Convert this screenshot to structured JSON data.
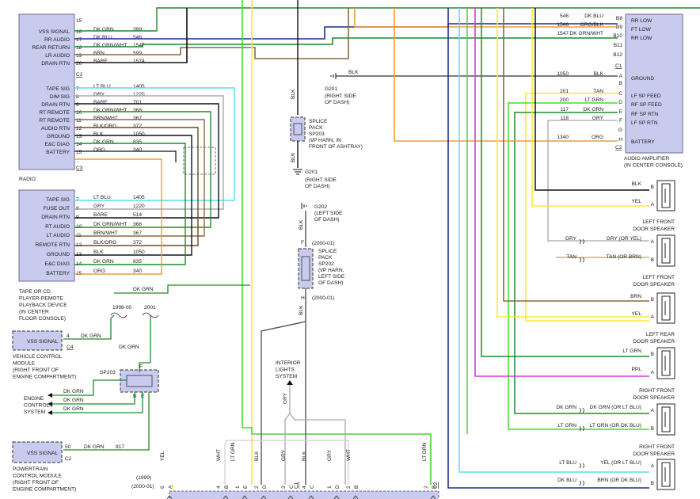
{
  "components": {
    "radio": {
      "name": "RADIO",
      "pins": [
        {
          "pin": "15",
          "label": "",
          "wire": "",
          "circuit": ""
        },
        {
          "pin": "16",
          "label": "VSS SIGNAL",
          "wire": "DK GRN",
          "circuit": "389"
        },
        {
          "pin": "17",
          "label": "RR AUDIO",
          "wire": "DK BLU",
          "circuit": "546"
        },
        {
          "pin": "18",
          "label": "REAR RETURN",
          "wire": "DK GRN/WHT",
          "circuit": "1547"
        },
        {
          "pin": "19",
          "label": "LR AUDIO",
          "wire": "BRN",
          "circuit": "599"
        },
        {
          "pin": "20",
          "label": "DRAIN RTN",
          "wire": "BARE",
          "circuit": "1574"
        },
        {
          "pin": "7",
          "label": "TAPE SIG",
          "wire": "LT BLU",
          "circuit": "1405"
        },
        {
          "pin": "8",
          "label": "DIM SIG",
          "wire": "GRY",
          "circuit": "1220"
        },
        {
          "pin": "9",
          "label": "DRAIN RTN",
          "wire": "BARE",
          "circuit": "701"
        },
        {
          "pin": "10",
          "label": "RT REMOTE",
          "wire": "DK GRN/WHT",
          "circuit": "368"
        },
        {
          "pin": "11",
          "label": "RT REMOTE",
          "wire": "BRN/WHT",
          "circuit": "367"
        },
        {
          "pin": "12",
          "label": "AUDIO RTN",
          "wire": "BLK/ORG",
          "circuit": "372"
        },
        {
          "pin": "13",
          "label": "GROUND",
          "wire": "BLK",
          "circuit": "1050"
        },
        {
          "pin": "14",
          "label": "E&C DIAG",
          "wire": "DK GRN",
          "circuit": "835"
        },
        {
          "pin": "15",
          "label": "BATTERY",
          "wire": "ORG",
          "circuit": "340"
        }
      ],
      "connectors": [
        "C2",
        "C3"
      ]
    },
    "tape": {
      "name_lines": [
        "TAPE OR CD",
        "PLAYER-REMOTE",
        "PLAYBACK DEVICE",
        "(IN CENTER",
        "FLOOR CONSOLE)"
      ],
      "pins": [
        {
          "pin": "7",
          "label": "TAPE SIG",
          "wire": "LT BLU",
          "circuit": "1405"
        },
        {
          "pin": "8",
          "label": "FUSE OUT",
          "wire": "GRY",
          "circuit": "1220"
        },
        {
          "pin": "9",
          "label": "DRAIN RTN",
          "wire": "BARE",
          "circuit": "514"
        },
        {
          "pin": "10",
          "label": "RT AUDIO",
          "wire": "DK GRN/WHT",
          "circuit": "368"
        },
        {
          "pin": "11",
          "label": "LT AUDIO",
          "wire": "BRN/WHT",
          "circuit": "367"
        },
        {
          "pin": "12",
          "label": "REMOTE RTN",
          "wire": "BLK/ORG",
          "circuit": "372"
        },
        {
          "pin": "13",
          "label": "GROUND",
          "wire": "BLK",
          "circuit": "1050"
        },
        {
          "pin": "14",
          "label": "E&C DIAG",
          "wire": "DK GRN",
          "circuit": "835"
        },
        {
          "pin": "15",
          "label": "BATTERY",
          "wire": "ORG",
          "circuit": "340"
        }
      ]
    },
    "amplifier": {
      "name_lines": [
        "AUDIO AMPLIFIER",
        "(IN CENTER CONSOLE)"
      ],
      "pins": [
        {
          "pin": "B8",
          "label": "RR LOW",
          "wire": "DK BLU",
          "circuit": "546"
        },
        {
          "pin": "B9",
          "label": "FT LOW",
          "wire": "ORG/BLK",
          "circuit": "1546"
        },
        {
          "pin": "B10",
          "label": "RR LOW",
          "wire": "DK GRN/WHT",
          "circuit": "1547"
        },
        {
          "pin": "B11",
          "label": "",
          "wire": "",
          "circuit": ""
        },
        {
          "pin": "B12",
          "label": "",
          "wire": "",
          "circuit": ""
        },
        {
          "pin": "A",
          "label": "GROUND",
          "wire": "BLK",
          "circuit": "1050"
        },
        {
          "pin": "B",
          "label": "",
          "wire": "",
          "circuit": ""
        },
        {
          "pin": "C",
          "label": "LF SP FEED",
          "wire": "TAN",
          "circuit": "201"
        },
        {
          "pin": "D",
          "label": "RF SP FEED",
          "wire": "LT GRN",
          "circuit": "200"
        },
        {
          "pin": "E",
          "label": "RF SP RTN",
          "wire": "DK GRN",
          "circuit": "117"
        },
        {
          "pin": "F",
          "label": "LF SP RTN",
          "wire": "GRY",
          "circuit": "118"
        },
        {
          "pin": "G",
          "label": "",
          "wire": "",
          "circuit": ""
        },
        {
          "pin": "H",
          "label": "BATTERY",
          "wire": "ORG",
          "circuit": "1340"
        }
      ],
      "connectors": [
        "C1",
        "C2"
      ]
    },
    "vcm": {
      "label": "VSS SIGNAL",
      "pin": "4",
      "wire": "DK GRN",
      "connector": "C4",
      "name_lines": [
        "VEHICLE CONTROL",
        "MODULE",
        "(RIGHT FRONT OF",
        "ENGINE COMPARTMENT)"
      ]
    },
    "pcm": {
      "label": "VSS SIGNAL",
      "pin": "50",
      "wire": "DK GRN",
      "circuit": "817",
      "connector": "C2",
      "name_lines": [
        "POWERTRAIN",
        "CONTROL MODULE",
        "(RIGHT FRONT OF",
        "ENGINE COMPARTMENT)"
      ]
    },
    "ecs": {
      "name_lines": [
        "ENGINE",
        "CONTROLS",
        "SYSTEM"
      ],
      "wires": [
        "DK GRN",
        "DK GRN",
        "DK GRN"
      ]
    },
    "sp203_small": {
      "label": "SP203",
      "pins": [
        "F",
        "B",
        "E"
      ],
      "in_wire": "DK GRN",
      "years": [
        "1998-00",
        "2001"
      ]
    },
    "interior": {
      "name_lines": [
        "INTERIOR",
        "LIGHTS",
        "SYSTEM"
      ],
      "wire": "GRY"
    }
  },
  "splices": {
    "sp203": {
      "lines": [
        "SPLICE",
        "PACK",
        "SP203",
        "(I/P HARN, IN",
        "FRONT OF ASHTRAY)"
      ],
      "wire_above": "BLK",
      "wire_below": "BLK"
    },
    "sp202": {
      "lines": [
        "SPLICE",
        "PACK",
        "SP202",
        "(I/P HARN,",
        "LEFT SIDE",
        "OF DASH)"
      ],
      "pin_top": "F",
      "pin_bottom": "H",
      "year_top": "(2000-01)",
      "year_bottom": "(2000-01)",
      "wire_above": "BLK",
      "wire_below": "BLK"
    }
  },
  "grounds": {
    "g201a": {
      "name": "G201",
      "lines": [
        "(RIGHT SIDE",
        "OF DASH)"
      ]
    },
    "g201b": {
      "name": "G201",
      "lines": [
        "(RIGHT SIDE",
        "OF DASH)"
      ]
    },
    "g202": {
      "name": "G202",
      "lines": [
        "(LEFT SIDE",
        "OF DASH)"
      ]
    },
    "amp_ground_wire": "BLK"
  },
  "speakers": [
    {
      "title_lines": [
        "LEFT FRONT",
        "DOOR SPEAKER"
      ],
      "wires": [
        {
          "pin": "B",
          "wire": "BLK"
        },
        {
          "pin": "A",
          "wire": "YEL"
        }
      ]
    },
    {
      "title_lines": [
        "LEFT FRONT",
        "DOOR SPEAKER"
      ],
      "wires": [
        {
          "pin": "A",
          "wire": "GRY (OR YEL)",
          "left_wire": "GRY"
        },
        {
          "pin": "B",
          "wire": "TAN (OR BRN)",
          "left_wire": "TAN"
        }
      ]
    },
    {
      "title_lines": [
        "LEFT REAR",
        "DOOR SPEAKER"
      ],
      "wires": [
        {
          "pin": "B",
          "wire": "BRN"
        },
        {
          "pin": "A",
          "wire": "YEL"
        }
      ]
    },
    {
      "title_lines": [
        "RIGHT FRONT",
        "DOOR SPEAKER"
      ],
      "wires": [
        {
          "pin": "B",
          "wire": "LT GRN"
        },
        {
          "pin": "A",
          "wire": "PPL"
        }
      ]
    },
    {
      "title_lines": [
        "RIGHT FRONT",
        "DOOR SPEAKER"
      ],
      "wires": [
        {
          "pin": "A",
          "wire": "DK GRN (OR LT BLU)",
          "left_wire": "DK GRN"
        },
        {
          "pin": "B",
          "wire": "LT GRN (OR DK BLU)",
          "left_wire": "LT GRN"
        }
      ]
    },
    {
      "title_lines": [],
      "wires": [
        {
          "pin": "A",
          "wire": "YEL (OR LT BLU)",
          "left_wire": "LT BLU"
        },
        {
          "pin": "B",
          "wire": "BRN (OR DK BLU)",
          "left_wire": "DK BLU"
        }
      ]
    }
  ],
  "bottom_connector": {
    "years": [
      "(1999)",
      "(2000-01)"
    ],
    "pins": [
      {
        "pin": "6",
        "letter": "A",
        "wire": "YEL"
      },
      {
        "pin": "4",
        "letter": "B",
        "wire": "WHT"
      },
      {
        "pin": "1",
        "letter": "E",
        "wire": "LT GRN"
      },
      {
        "pin": "2",
        "letter": "D",
        "wire": "BLK"
      },
      {
        "pin": "3",
        "letter": "C",
        "wire": "GRY"
      },
      {
        "pin": "4",
        "letter": "C",
        "wire": "BLK"
      },
      {
        "pin": "1",
        "letter": "D",
        "wire": "GRY"
      },
      {
        "pin": "2",
        "letter": "B",
        "wire": "WHT"
      },
      {
        "pin": "2",
        "letter": "B",
        "wire": "LT GRN"
      }
    ],
    "connectors": [
      "C1",
      "C2"
    ]
  },
  "colors": {
    "dk_grn": "#1f8a2a",
    "lt_grn": "#46d832",
    "dk_blu": "#1a2f8c",
    "lt_blu": "#54e0e6",
    "orange": "#f29a36",
    "brown": "#8a6b3a",
    "yellow": "#ffe830",
    "gray": "#a8a8a8",
    "black": "#111111",
    "purple": "#d83ad8",
    "tan": "#b9a46e",
    "blk_org": "#6a4a26",
    "box": "#c9cbee"
  }
}
